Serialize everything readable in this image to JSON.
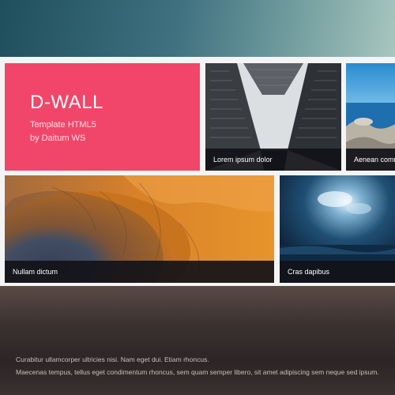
{
  "header_band": {},
  "brand": {
    "title": "D-WALL",
    "subtitle_line1": "Template HTML5",
    "subtitle_line2": "by Daitum WS",
    "color": "#f1466a"
  },
  "tiles": [
    {
      "caption": "Lorem ipsum dolor",
      "photo": "skyscrapers-upward"
    },
    {
      "caption": "Aenean commodo",
      "photo": "coastal-rocks"
    },
    {
      "caption": "Nullam dictum",
      "photo": "martian-crater"
    },
    {
      "caption": "Cras dapibus",
      "photo": "stormy-sea-clouds"
    }
  ],
  "footer": {
    "line1": "Curabitur ullamcorper ultricies nisi. Nam eget dui. Etiam rhoncus.",
    "line2": "Maecenas tempus, tellus eget condimentum rhoncus, sem quam semper libero, sit amet adipiscing sem neque sed ipsum."
  }
}
